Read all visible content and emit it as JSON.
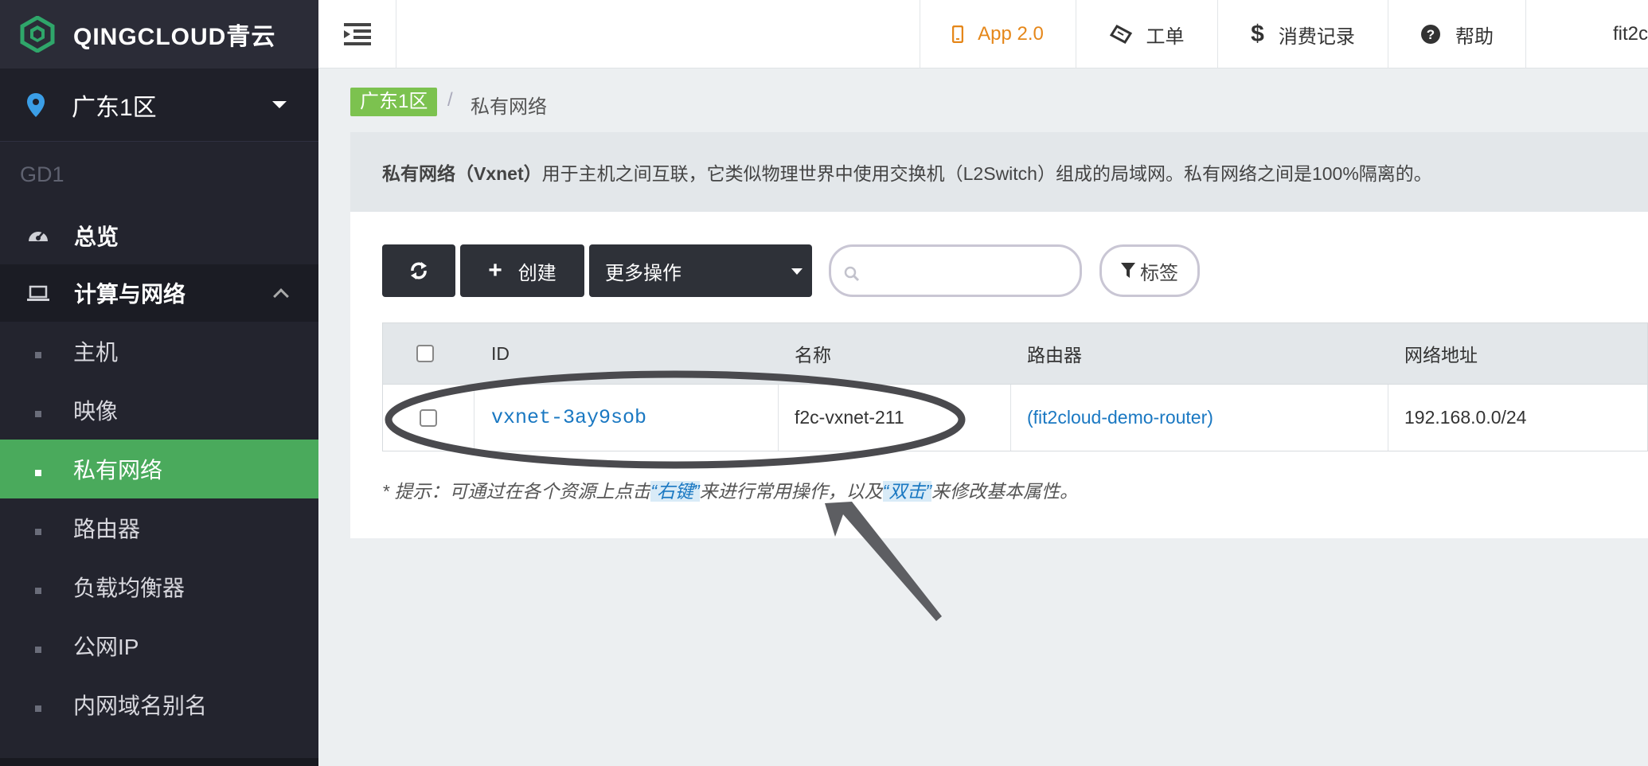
{
  "brand": {
    "name": "QINGCLOUD青云"
  },
  "sidebar": {
    "region": "广东1区",
    "group": "GD1",
    "overview": "总览",
    "section": "计算与网络",
    "items": [
      {
        "label": "主机"
      },
      {
        "label": "映像"
      },
      {
        "label": "私有网络"
      },
      {
        "label": "路由器"
      },
      {
        "label": "负载均衡器"
      },
      {
        "label": "公网IP"
      },
      {
        "label": "内网域名别名"
      }
    ]
  },
  "topbar": {
    "app": "App 2.0",
    "ticket": "工单",
    "billing": "消费记录",
    "help": "帮助",
    "user": "fit2c"
  },
  "breadcrumb": {
    "region": "广东1区",
    "separator": "/",
    "current": "私有网络"
  },
  "info": {
    "title": "私有网络（Vxnet）",
    "description": "用于主机之间互联，它类似物理世界中使用交换机（L2Switch）组成的局域网。私有网络之间是100%隔离的。"
  },
  "toolbar": {
    "create": "创建",
    "more": "更多操作",
    "search_placeholder": "",
    "tags": "标签"
  },
  "table": {
    "columns": [
      "ID",
      "名称",
      "路由器",
      "网络地址"
    ],
    "rows": [
      {
        "id": "vxnet-3ay9sob",
        "name": "f2c-vxnet-211",
        "router": "(fit2cloud-demo-router)",
        "network": "192.168.0.0/24"
      }
    ]
  },
  "hint": {
    "prefix": "* 提示：可通过在各个资源上点击",
    "right_click": "“右键”",
    "middle": "来进行常用操作，以及",
    "double_click": "“双击”",
    "suffix": "来修改基本属性。"
  },
  "colors": {
    "active": "#4aaa5c",
    "accent": "#e5871a",
    "link": "#1a78c2",
    "region_tag": "#7cc24f"
  }
}
